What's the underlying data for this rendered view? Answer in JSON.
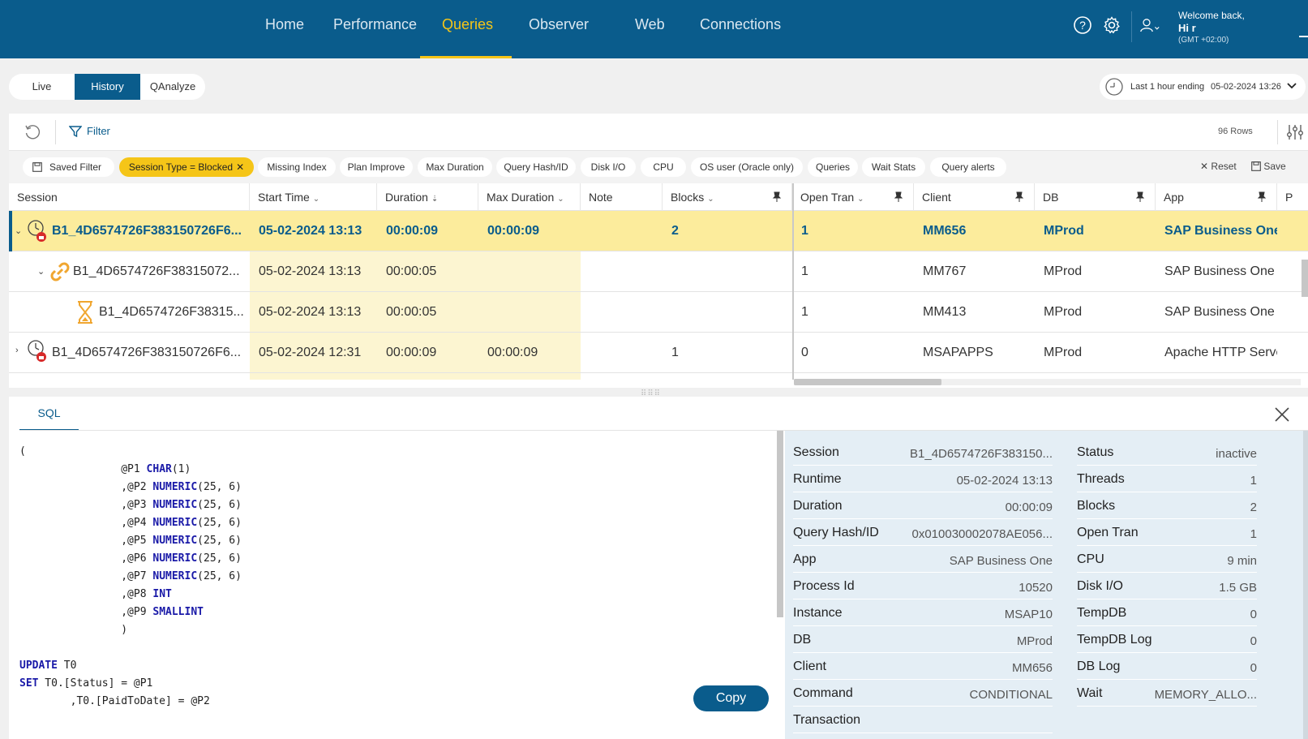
{
  "nav": {
    "items": [
      {
        "label": "Home",
        "active": false
      },
      {
        "label": "Performance",
        "active": false
      },
      {
        "label": "Queries",
        "active": true
      },
      {
        "label": "Observer",
        "active": false
      },
      {
        "label": "Web",
        "active": false
      },
      {
        "label": "Connections",
        "active": false
      }
    ]
  },
  "user": {
    "welcome": "Welcome back,",
    "name": "Hi r",
    "timezone": "(GMT +02:00)"
  },
  "modes": [
    {
      "label": "Live",
      "active": false
    },
    {
      "label": "History",
      "active": true
    },
    {
      "label": "QAnalyze",
      "active": false
    }
  ],
  "timerange": {
    "label": "Last 1 hour ending",
    "value": "05-02-2024 13:26"
  },
  "toolbar": {
    "filter_label": "Filter",
    "rows": "96 Rows"
  },
  "chips": [
    {
      "label": "Saved Filter",
      "active": false
    },
    {
      "label": "Session Type = Blocked",
      "active": true
    },
    {
      "label": "Missing Index",
      "active": false
    },
    {
      "label": "Plan Improve",
      "active": false
    },
    {
      "label": "Max Duration",
      "active": false
    },
    {
      "label": "Query Hash/ID",
      "active": false
    },
    {
      "label": "Disk I/O",
      "active": false
    },
    {
      "label": "CPU",
      "active": false
    },
    {
      "label": "OS user (Oracle only)",
      "active": false
    },
    {
      "label": "Queries",
      "active": false
    },
    {
      "label": "Wait Stats",
      "active": false
    },
    {
      "label": "Query alerts",
      "active": false
    }
  ],
  "actions": {
    "reset": "Reset",
    "save": "Save"
  },
  "table": {
    "columns": [
      "Session",
      "Start Time",
      "Duration",
      "Max Duration",
      "Note",
      "Blocks",
      "Open Tran",
      "Client",
      "DB",
      "App",
      "P"
    ],
    "rows": [
      {
        "session": "B1_4D6574726F383150726F6...",
        "start": "05-02-2024 13:13",
        "duration": "00:00:09",
        "max_duration": "00:00:09",
        "note": "",
        "blocks": "2",
        "open_tran": "1",
        "client": "MM656",
        "db": "MProd",
        "app": "SAP Business One"
      },
      {
        "session": "B1_4D6574726F38315072...",
        "start": "05-02-2024 13:13",
        "duration": "00:00:05",
        "max_duration": "",
        "note": "",
        "blocks": "",
        "open_tran": "1",
        "client": "MM767",
        "db": "MProd",
        "app": "SAP Business One"
      },
      {
        "session": "B1_4D6574726F38315...",
        "start": "05-02-2024 13:13",
        "duration": "00:00:05",
        "max_duration": "",
        "note": "",
        "blocks": "",
        "open_tran": "1",
        "client": "MM413",
        "db": "MProd",
        "app": "SAP Business One"
      },
      {
        "session": "B1_4D6574726F383150726F6...",
        "start": "05-02-2024 12:31",
        "duration": "00:00:09",
        "max_duration": "00:00:09",
        "note": "",
        "blocks": "1",
        "open_tran": "0",
        "client": "MSAPAPPS",
        "db": "MProd",
        "app": "Apache HTTP Server"
      }
    ]
  },
  "detail": {
    "tab": "SQL",
    "copy_label": "Copy",
    "sql_lines": [
      [
        {
          "t": "("
        }
      ],
      [
        {
          "t": "                @P1 "
        },
        {
          "t": "CHAR",
          "kw": true
        },
        {
          "t": "(1)"
        }
      ],
      [
        {
          "t": "                ,@P2 "
        },
        {
          "t": "NUMERIC",
          "kw": true
        },
        {
          "t": "(25, 6)"
        }
      ],
      [
        {
          "t": "                ,@P3 "
        },
        {
          "t": "NUMERIC",
          "kw": true
        },
        {
          "t": "(25, 6)"
        }
      ],
      [
        {
          "t": "                ,@P4 "
        },
        {
          "t": "NUMERIC",
          "kw": true
        },
        {
          "t": "(25, 6)"
        }
      ],
      [
        {
          "t": "                ,@P5 "
        },
        {
          "t": "NUMERIC",
          "kw": true
        },
        {
          "t": "(25, 6)"
        }
      ],
      [
        {
          "t": "                ,@P6 "
        },
        {
          "t": "NUMERIC",
          "kw": true
        },
        {
          "t": "(25, 6)"
        }
      ],
      [
        {
          "t": "                ,@P7 "
        },
        {
          "t": "NUMERIC",
          "kw": true
        },
        {
          "t": "(25, 6)"
        }
      ],
      [
        {
          "t": "                ,@P8 "
        },
        {
          "t": "INT",
          "kw": true
        }
      ],
      [
        {
          "t": "                ,@P9 "
        },
        {
          "t": "SMALLINT",
          "kw": true
        }
      ],
      [
        {
          "t": "                )"
        }
      ],
      [
        {
          "t": ""
        }
      ],
      [
        {
          "t": "UPDATE",
          "kw": true
        },
        {
          "t": " T0"
        }
      ],
      [
        {
          "t": "SET",
          "kw": true
        },
        {
          "t": " T0.[Status] = @P1"
        }
      ],
      [
        {
          "t": "        ,T0.[PaidToDate] = @P2"
        }
      ]
    ],
    "props_left": [
      {
        "k": "Session",
        "v": "B1_4D6574726F383150..."
      },
      {
        "k": "Runtime",
        "v": "05-02-2024 13:13"
      },
      {
        "k": "Duration",
        "v": "00:00:09"
      },
      {
        "k": "Query Hash/ID",
        "v": "0x010030002078AE056..."
      },
      {
        "k": "App",
        "v": "SAP Business One"
      },
      {
        "k": "Process Id",
        "v": "10520"
      },
      {
        "k": "Instance",
        "v": "MSAP10"
      },
      {
        "k": "DB",
        "v": "MProd"
      },
      {
        "k": "Client",
        "v": "MM656"
      },
      {
        "k": "Command",
        "v": "CONDITIONAL"
      },
      {
        "k": "Transaction",
        "v": ""
      }
    ],
    "props_right": [
      {
        "k": "Status",
        "v": "inactive"
      },
      {
        "k": "Threads",
        "v": "1"
      },
      {
        "k": "Blocks",
        "v": "2"
      },
      {
        "k": "Open Tran",
        "v": "1"
      },
      {
        "k": "CPU",
        "v": "9 min"
      },
      {
        "k": "Disk I/O",
        "v": "1.5 GB"
      },
      {
        "k": "TempDB",
        "v": "0"
      },
      {
        "k": "TempDB Log",
        "v": "0"
      },
      {
        "k": "DB Log",
        "v": "0"
      },
      {
        "k": "Wait",
        "v": "MEMORY_ALLO..."
      }
    ]
  }
}
